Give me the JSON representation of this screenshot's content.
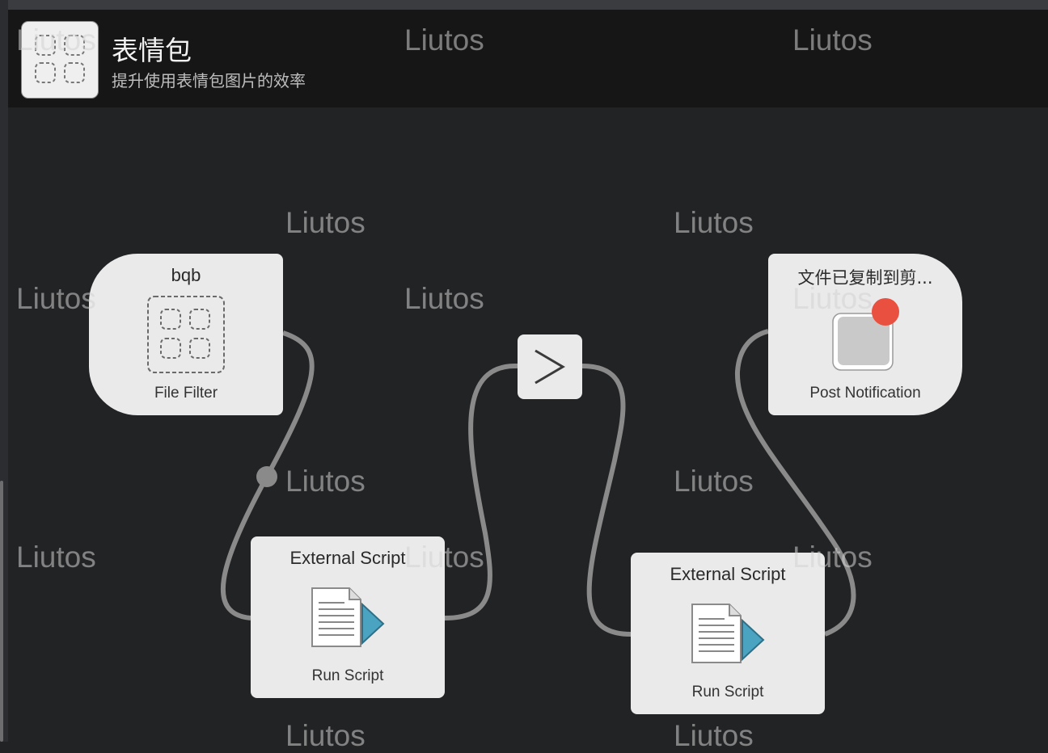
{
  "workflow": {
    "icon": "emoji-grid-icon",
    "title": "表情包",
    "subtitle": "提升使用表情包图片的效率"
  },
  "nodes": {
    "file_filter": {
      "title": "bqb",
      "subtitle": "File Filter",
      "icon": "dashed-grid-icon"
    },
    "script_1": {
      "title": "External Script",
      "subtitle": "Run Script",
      "icon": "script-document-icon"
    },
    "conditional": {
      "label": ">",
      "icon": "chevron-right-icon"
    },
    "script_2": {
      "title": "External Script",
      "subtitle": "Run Script",
      "icon": "script-document-icon"
    },
    "notification": {
      "title": "文件已复制到剪...",
      "subtitle": "Post Notification",
      "icon": "notification-app-icon"
    }
  },
  "watermark": {
    "text": "Liutos"
  },
  "colors": {
    "canvas": "#222325",
    "header": "#161617",
    "node": "#eaeaea",
    "wire": "#8a8a8a",
    "badge": "#e9503f",
    "play_arrow": "#4aa3c0"
  }
}
